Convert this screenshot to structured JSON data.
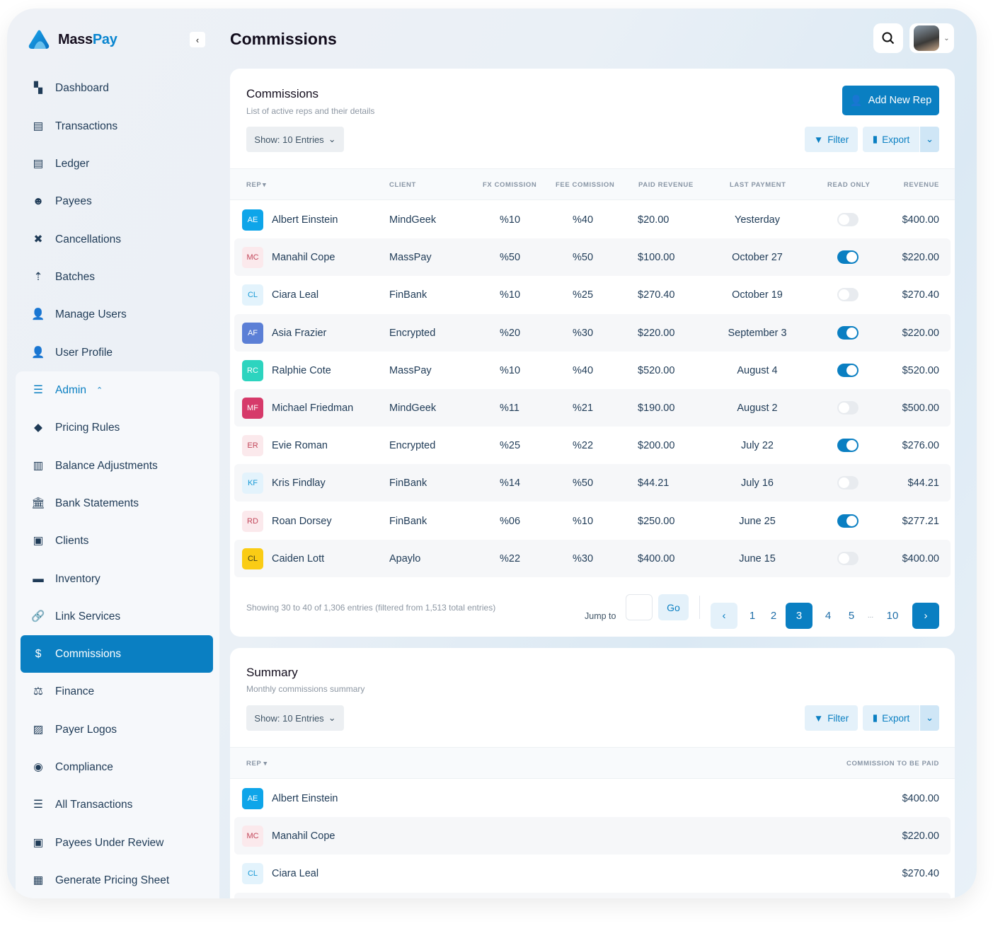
{
  "app": {
    "brand_a": "Mass",
    "brand_b": "Pay",
    "page_title": "Commissions"
  },
  "colors": {
    "accent": "#0a7fc2"
  },
  "sidebar": {
    "items": [
      {
        "label": "Dashboard",
        "icon": "dashboard-icon"
      },
      {
        "label": "Transactions",
        "icon": "receipt-icon"
      },
      {
        "label": "Ledger",
        "icon": "document-icon"
      },
      {
        "label": "Payees",
        "icon": "payees-icon"
      },
      {
        "label": "Cancellations",
        "icon": "cancel-icon"
      },
      {
        "label": "Batches",
        "icon": "upload-folder-icon"
      },
      {
        "label": "Manage Users",
        "icon": "user-gear-icon"
      },
      {
        "label": "User Profile",
        "icon": "user-icon"
      },
      {
        "label": "Admin",
        "icon": "admin-icon"
      },
      {
        "label": "Pricing Rules",
        "icon": "tag-icon"
      },
      {
        "label": "Balance Adjustments",
        "icon": "chart-doc-icon"
      },
      {
        "label": "Bank Statements",
        "icon": "bank-icon"
      },
      {
        "label": "Clients",
        "icon": "contact-icon"
      },
      {
        "label": "Inventory",
        "icon": "inventory-icon"
      },
      {
        "label": "Link Services",
        "icon": "link-icon"
      },
      {
        "label": "Commissions",
        "icon": "dollar-doc-icon"
      },
      {
        "label": "Finance",
        "icon": "scale-icon"
      },
      {
        "label": "Payer Logos",
        "icon": "image-icon"
      },
      {
        "label": "Compliance",
        "icon": "eye-icon"
      },
      {
        "label": "All Transactions",
        "icon": "list-doc-icon"
      },
      {
        "label": "Payees Under Review",
        "icon": "lock-folder-icon"
      },
      {
        "label": "Generate Pricing Sheet",
        "icon": "table-icon"
      }
    ],
    "active": "Commissions"
  },
  "commissions": {
    "title": "Commissions",
    "subtitle": "List of active reps and their details",
    "show_label": "Show: 10 Entries",
    "add_label": "Add New Rep",
    "filter_label": "Filter",
    "export_label": "Export",
    "columns": [
      "REP",
      "CLIENT",
      "FX COMISSION",
      "FEE COMISSION",
      "PAID REVENUE",
      "LAST PAYMENT",
      "READ ONLY",
      "REVENUE"
    ],
    "rows": [
      {
        "initials": "AE",
        "rep": "Albert Einstein",
        "client": "MindGeek",
        "fx": "%10",
        "fee": "%40",
        "paid": "$20.00",
        "last": "Yesterday",
        "read_only": false,
        "revenue": "$400.00",
        "avatar_bg": "#0ea5e9",
        "avatar_fg": "#ffffff"
      },
      {
        "initials": "MC",
        "rep": "Manahil Cope",
        "client": "MassPay",
        "fx": "%50",
        "fee": "%50",
        "paid": "$100.00",
        "last": "October 27",
        "read_only": true,
        "revenue": "$220.00",
        "avatar_bg": "#fbe9ec",
        "avatar_fg": "#c2475a"
      },
      {
        "initials": "CL",
        "rep": "Ciara Leal",
        "client": "FinBank",
        "fx": "%10",
        "fee": "%25",
        "paid": "$270.40",
        "last": "October 19",
        "read_only": false,
        "revenue": "$270.40",
        "avatar_bg": "#e3f3fc",
        "avatar_fg": "#1a9ad6"
      },
      {
        "initials": "AF",
        "rep": "Asia Frazier",
        "client": "Encrypted",
        "fx": "%20",
        "fee": "%30",
        "paid": "$220.00",
        "last": "September 3",
        "read_only": true,
        "revenue": "$220.00",
        "avatar_bg": "#5b7fd6",
        "avatar_fg": "#ffffff"
      },
      {
        "initials": "RC",
        "rep": "Ralphie Cote",
        "client": "MassPay",
        "fx": "%10",
        "fee": "%40",
        "paid": "$520.00",
        "last": "August 4",
        "read_only": true,
        "revenue": "$520.00",
        "avatar_bg": "#2dd4bf",
        "avatar_fg": "#ffffff"
      },
      {
        "initials": "MF",
        "rep": "Michael Friedman",
        "client": "MindGeek",
        "fx": "%11",
        "fee": "%21",
        "paid": "$190.00",
        "last": "August 2",
        "read_only": false,
        "revenue": "$500.00",
        "avatar_bg": "#d63a6a",
        "avatar_fg": "#ffffff"
      },
      {
        "initials": "ER",
        "rep": "Evie Roman",
        "client": "Encrypted",
        "fx": "%25",
        "fee": "%22",
        "paid": "$200.00",
        "last": "July 22",
        "read_only": true,
        "revenue": "$276.00",
        "avatar_bg": "#fbe9ec",
        "avatar_fg": "#c2475a"
      },
      {
        "initials": "KF",
        "rep": "Kris Findlay",
        "client": "FinBank",
        "fx": "%14",
        "fee": "%50",
        "paid": "$44.21",
        "last": "July 16",
        "read_only": false,
        "revenue": "$44.21",
        "avatar_bg": "#e3f3fc",
        "avatar_fg": "#1a9ad6"
      },
      {
        "initials": "RD",
        "rep": "Roan Dorsey",
        "client": "FinBank",
        "fx": "%06",
        "fee": "%10",
        "paid": "$250.00",
        "last": "June 25",
        "read_only": true,
        "revenue": "$277.21",
        "avatar_bg": "#fbe9ec",
        "avatar_fg": "#c2475a"
      },
      {
        "initials": "CL",
        "rep": "Caiden Lott",
        "client": "Apaylo",
        "fx": "%22",
        "fee": "%30",
        "paid": "$400.00",
        "last": "June 15",
        "read_only": false,
        "revenue": "$400.00",
        "avatar_bg": "#facc15",
        "avatar_fg": "#3b3b1a"
      }
    ],
    "footer": {
      "showing": "Showing 30  to 40 of 1,306 entries (filtered from 1,513 total entries)",
      "jump_label": "Jump to",
      "jump_value": "",
      "go_label": "Go",
      "pages": [
        "1",
        "2",
        "3",
        "4",
        "5",
        "...",
        "10"
      ],
      "current_page": "3",
      "prev": "‹",
      "next": "›"
    }
  },
  "summary": {
    "title": "Summary",
    "subtitle": "Monthly commissions summary",
    "show_label": "Show: 10 Entries",
    "filter_label": "Filter",
    "export_label": "Export",
    "columns": [
      "REP",
      "COMMISSION TO BE PAID"
    ],
    "rows": [
      {
        "initials": "AE",
        "rep": "Albert Einstein",
        "amount": "$400.00",
        "avatar_bg": "#0ea5e9",
        "avatar_fg": "#ffffff"
      },
      {
        "initials": "MC",
        "rep": "Manahil Cope",
        "amount": "$220.00",
        "avatar_bg": "#fbe9ec",
        "avatar_fg": "#c2475a"
      },
      {
        "initials": "CL",
        "rep": "Ciara Leal",
        "amount": "$270.40",
        "avatar_bg": "#e3f3fc",
        "avatar_fg": "#1a9ad6"
      }
    ]
  }
}
